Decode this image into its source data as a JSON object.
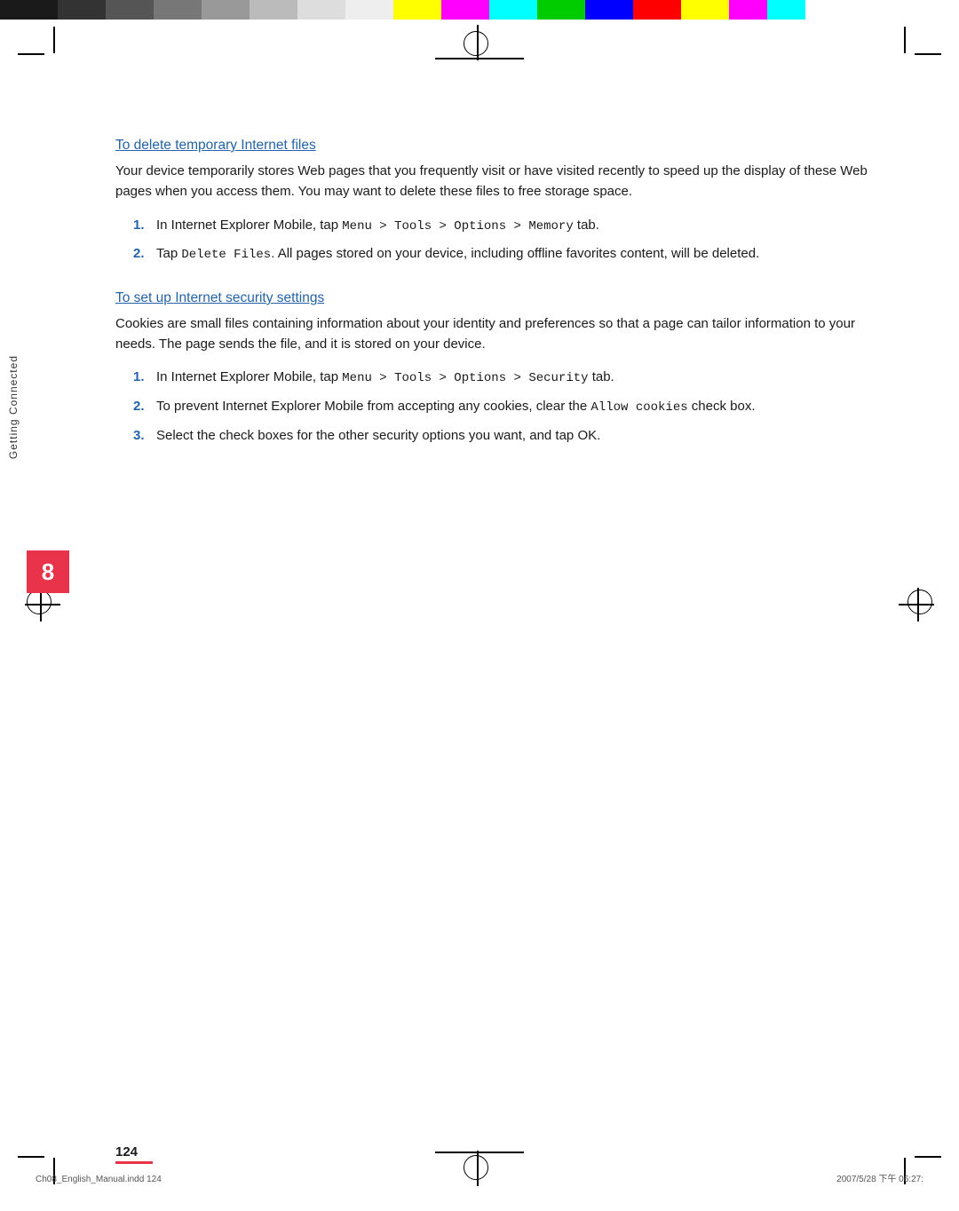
{
  "color_bar": [
    {
      "color": "#1a1a1a",
      "width": "6%"
    },
    {
      "color": "#333333",
      "width": "5%"
    },
    {
      "color": "#555555",
      "width": "5%"
    },
    {
      "color": "#777777",
      "width": "5%"
    },
    {
      "color": "#999999",
      "width": "5%"
    },
    {
      "color": "#bbbbbb",
      "width": "5%"
    },
    {
      "color": "#dddddd",
      "width": "5%"
    },
    {
      "color": "#ffffff",
      "width": "5%"
    },
    {
      "color": "#ffff00",
      "width": "5%"
    },
    {
      "color": "#ff00ff",
      "width": "5%"
    },
    {
      "color": "#00ffff",
      "width": "5%"
    },
    {
      "color": "#00ff00",
      "width": "5%"
    },
    {
      "color": "#0000ff",
      "width": "5%"
    },
    {
      "color": "#ff0000",
      "width": "5%"
    },
    {
      "color": "#ffff00",
      "width": "5%"
    },
    {
      "color": "#ff00ff",
      "width": "4%"
    },
    {
      "color": "#00ffff",
      "width": "4%"
    }
  ],
  "chapter": {
    "number": "8",
    "vertical_label": "Getting Connected"
  },
  "section1": {
    "heading": "To delete temporary Internet files",
    "body": "Your device temporarily stores Web pages that you frequently visit or have visited recently to speed up the display of these Web pages when you access them. You may want to delete these files to free storage space.",
    "steps": [
      {
        "number": "1.",
        "text_prefix": "In Internet Explorer Mobile, tap ",
        "text_mono": "Menu > Tools > Options > Memory",
        "text_suffix": " tab."
      },
      {
        "number": "2.",
        "text_prefix": "Tap ",
        "text_mono": "Delete Files",
        "text_suffix": ". All pages stored on your device, including offline favorites content, will be deleted."
      }
    ]
  },
  "section2": {
    "heading": "To set up Internet security settings",
    "body": "Cookies are small files containing information about your identity and preferences so that a page can tailor information to your needs. The page sends the file, and it is stored on your device.",
    "steps": [
      {
        "number": "1.",
        "text_prefix": "In Internet Explorer Mobile, tap ",
        "text_mono": "Menu > Tools > Options > Security",
        "text_suffix": " tab."
      },
      {
        "number": "2.",
        "text_prefix": "To prevent Internet Explorer Mobile from accepting any cookies, clear the ",
        "text_mono": "Allow cookies",
        "text_suffix": " check box."
      },
      {
        "number": "3.",
        "text": "Select the check boxes for the other security options you want, and tap OK."
      }
    ]
  },
  "page": {
    "number": "124"
  },
  "footer": {
    "left": "Ch08_English_Manual.indd    124",
    "right": "2007/5/28    下午 06:27:"
  }
}
